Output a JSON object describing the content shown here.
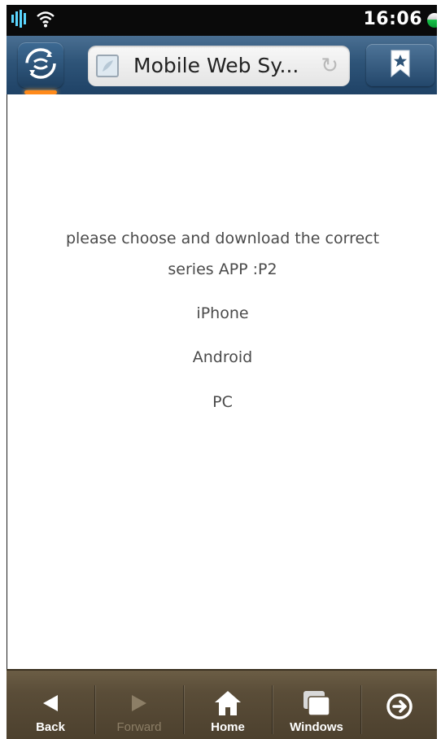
{
  "status_bar": {
    "time": "16:06",
    "icons": [
      "signal-icon",
      "wifi-icon",
      "battery-icon"
    ]
  },
  "browser": {
    "page_title": "Mobile Web Sy...",
    "icons": {
      "sync": "sync-icon",
      "favicon": "page-favicon",
      "reload": "reload-icon",
      "bookmark": "bookmark-icon"
    }
  },
  "content": {
    "message_line1": "please choose and download the correct",
    "message_line2": "series APP :P2",
    "options": [
      "iPhone",
      "Android",
      "PC"
    ]
  },
  "bottom_nav": {
    "back": "Back",
    "forward": "Forward",
    "home": "Home",
    "windows": "Windows",
    "exit_icon": "exit-icon"
  },
  "colors": {
    "toolbar": "#2e5478",
    "bottom_bar": "#5a4d38",
    "sync_glow": "#ff8a1a",
    "battery_green": "#18c24a",
    "text": "#4a4a4a"
  }
}
